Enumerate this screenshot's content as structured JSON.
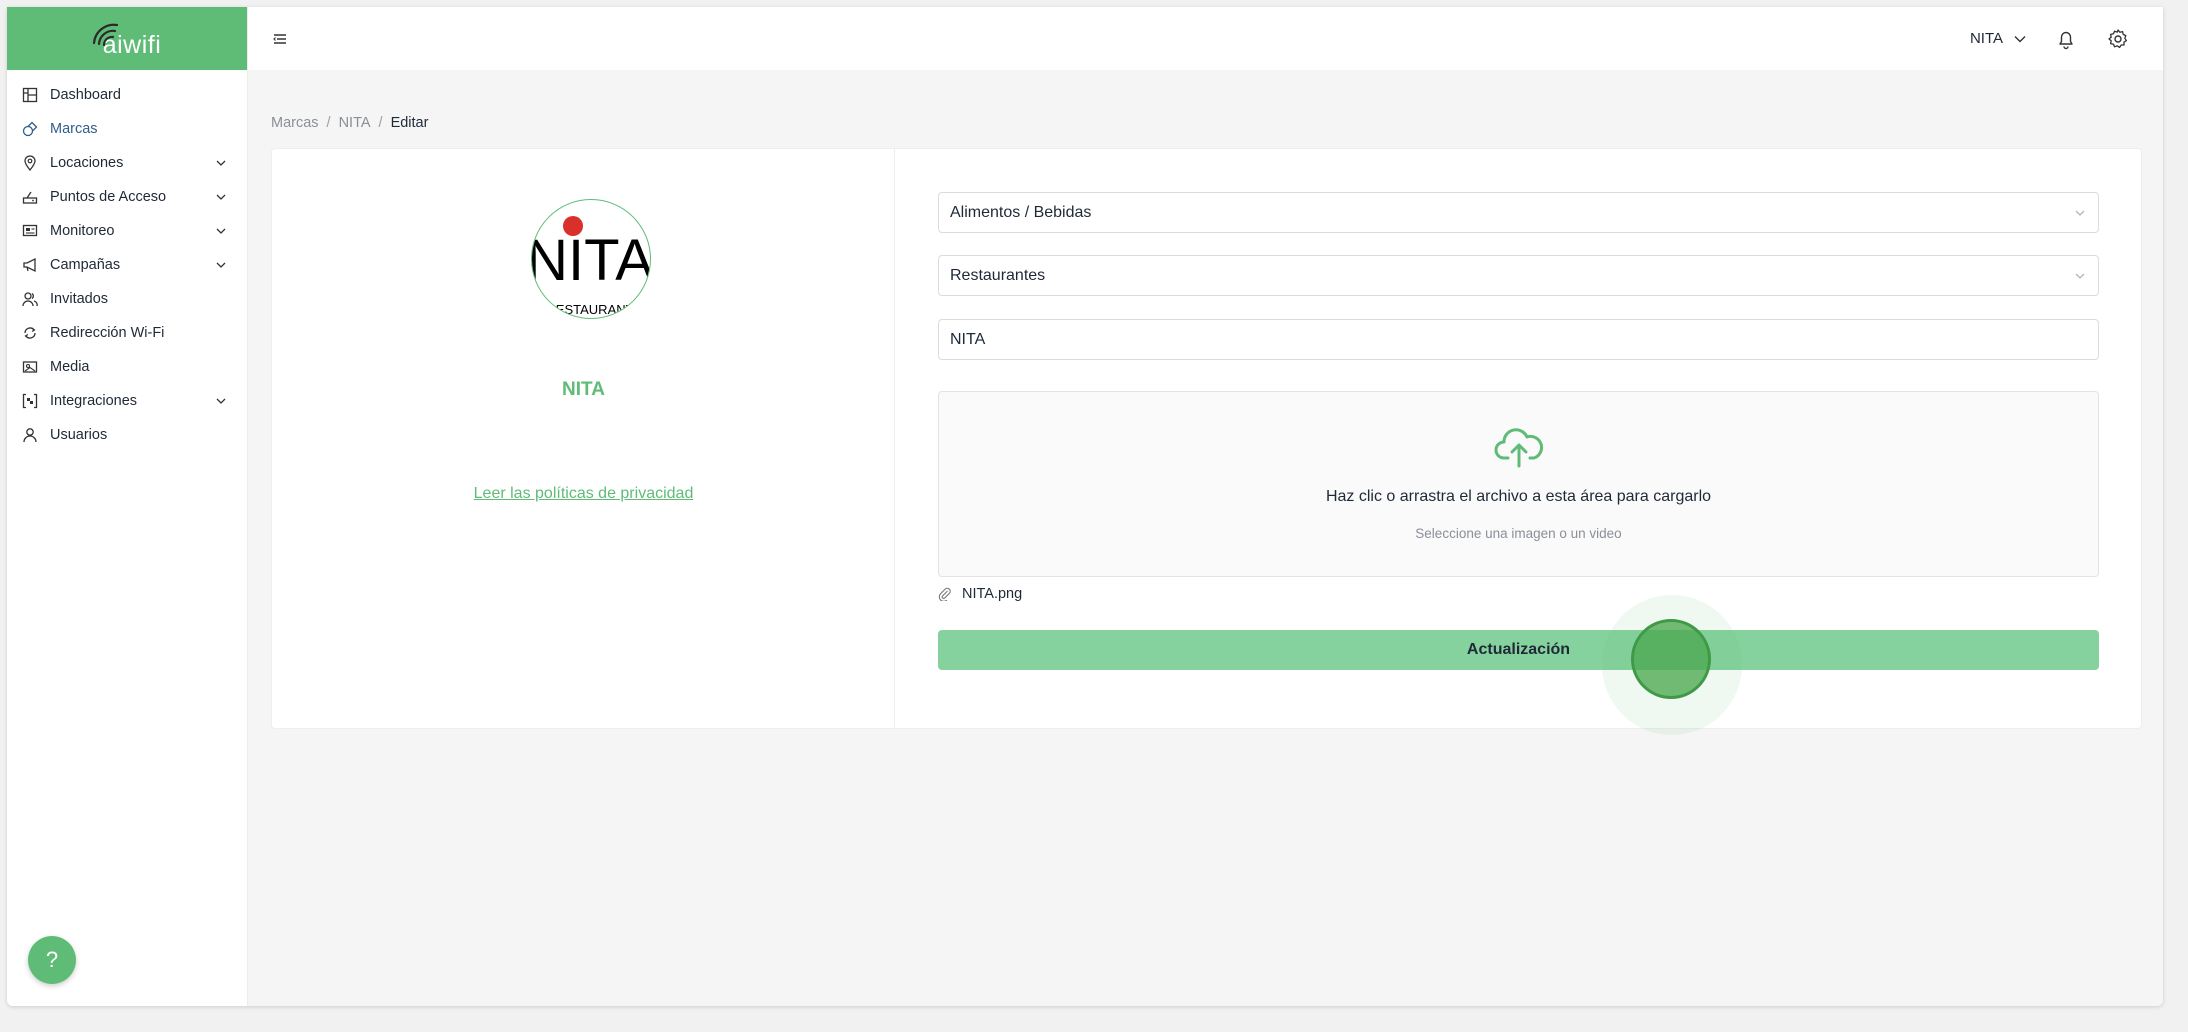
{
  "brand": {
    "logo_text": "aiwifi",
    "accent": "#5fbc76"
  },
  "sidebar": {
    "items": [
      {
        "label": "Dashboard",
        "icon": "dashboard-icon",
        "has_children": false
      },
      {
        "label": "Marcas",
        "icon": "brands-icon",
        "has_children": false,
        "active": true
      },
      {
        "label": "Locaciones",
        "icon": "location-pin-icon",
        "has_children": true
      },
      {
        "label": "Puntos de Acceso",
        "icon": "router-icon",
        "has_children": true
      },
      {
        "label": "Monitoreo",
        "icon": "monitor-icon",
        "has_children": true
      },
      {
        "label": "Campañas",
        "icon": "megaphone-icon",
        "has_children": true
      },
      {
        "label": "Invitados",
        "icon": "guests-icon",
        "has_children": false
      },
      {
        "label": "Redirección Wi-Fi",
        "icon": "redirect-icon",
        "has_children": false
      },
      {
        "label": "Media",
        "icon": "media-icon",
        "has_children": false
      },
      {
        "label": "Integraciones",
        "icon": "integrations-icon",
        "has_children": true
      },
      {
        "label": "Usuarios",
        "icon": "user-icon",
        "has_children": false
      }
    ],
    "help_label": "?"
  },
  "header": {
    "user_name": "NITA"
  },
  "breadcrumb": {
    "items": [
      "Marcas",
      "NITA"
    ],
    "current": "Editar",
    "separator": "/"
  },
  "profile": {
    "logo_text": "NITA",
    "logo_subtext": "RESTAURANT",
    "name": "NITA",
    "privacy_link": "Leer las políticas de privacidad"
  },
  "form": {
    "category": "Alimentos / Bebidas",
    "subcategory": "Restaurantes",
    "brand_name": "NITA",
    "upload_title": "Haz clic o arrastra el archivo a esta área para cargarlo",
    "upload_hint": "Seleccione una imagen o un video",
    "file_name": "NITA.png",
    "submit_label": "Actualización"
  }
}
